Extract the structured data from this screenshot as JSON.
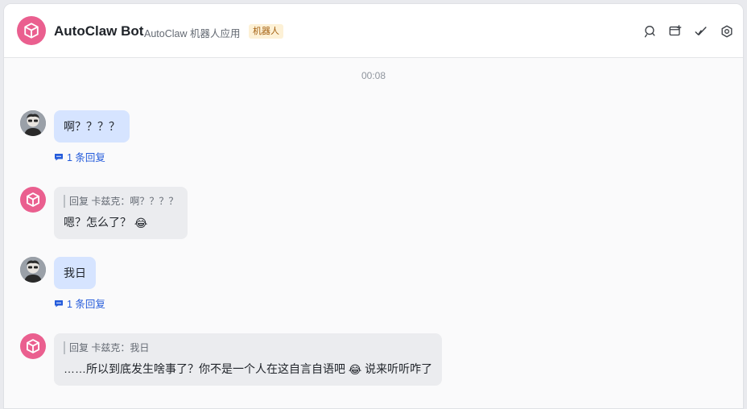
{
  "header": {
    "title": "AutoClaw Bot",
    "subtitle": "AutoClaw 机器人应用",
    "badge": "机器人",
    "icons": [
      "search-icon",
      "add-window-icon",
      "check-icon",
      "settings-icon"
    ]
  },
  "timestamp": "00:08",
  "messages": [
    {
      "from": "user",
      "text": "啊？？？？",
      "reply_count": "1 条回复"
    },
    {
      "from": "bot",
      "quote": "回复 卡兹克：啊？？？？",
      "text": "嗯？怎么了？",
      "emoji": "😂"
    },
    {
      "from": "user",
      "text": "我日",
      "reply_count": "1 条回复"
    },
    {
      "from": "bot",
      "quote": "回复 卡兹克：我日",
      "text_before": "……所以到底发生啥事了？你不是一个人在这自言自语吧",
      "emoji": "😂",
      "text_after": "说来听听咋了"
    }
  ],
  "colors": {
    "accent": "#245bdb",
    "bot_avatar": "#ea5f8f",
    "user_bubble": "#d6e4ff",
    "bot_bubble": "#ebecef"
  }
}
